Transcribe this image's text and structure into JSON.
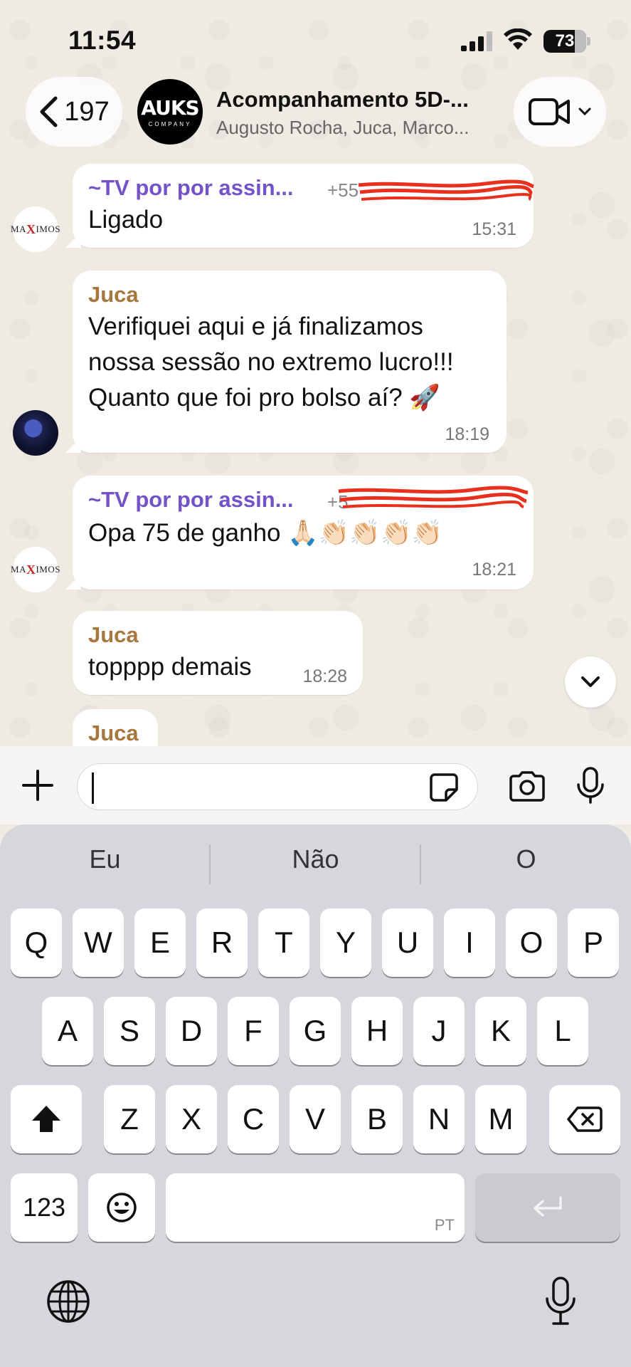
{
  "status_bar": {
    "time": "11:54",
    "battery_level": "73"
  },
  "header": {
    "back_count": "197",
    "group_logo_text": "AUKS",
    "group_logo_subtext": "COMPANY",
    "title": "Acompanhamento 5D-...",
    "subtitle": "Augusto Rocha, Juca, Marco..."
  },
  "messages": [
    {
      "sender": "~TV por por assin...",
      "phone": "+55",
      "text_lines": [
        "Ligado"
      ],
      "time": "15:31",
      "avatar": "maximos"
    },
    {
      "sender": "Juca",
      "text_lines": [
        "Verifiquei aqui e já finalizamos",
        "nossa sessão no extremo lucro!!!",
        "Quanto que foi pro bolso aí? 🚀"
      ],
      "time": "18:19",
      "avatar": "juca"
    },
    {
      "sender": "~TV por por assin...",
      "phone": "+5",
      "text_lines": [
        "Opa 75 de ganho 🙏🏻👏🏻👏🏻👏🏻👏🏻"
      ],
      "time": "18:21",
      "avatar": "maximos"
    },
    {
      "sender": "Juca",
      "text_lines": [
        "topppp demais"
      ],
      "time": "18:28"
    },
    {
      "sender": "Juca",
      "text_lines": [],
      "time": ""
    }
  ],
  "avatar_maximos_text": {
    "left": "MA",
    "x": "X",
    "right": "IMOS"
  },
  "composer": {
    "placeholder": ""
  },
  "keyboard": {
    "suggestions": [
      "Eu",
      "Não",
      "O"
    ],
    "row1": [
      "Q",
      "W",
      "E",
      "R",
      "T",
      "Y",
      "U",
      "I",
      "O",
      "P"
    ],
    "row2": [
      "A",
      "S",
      "D",
      "F",
      "G",
      "H",
      "J",
      "K",
      "L"
    ],
    "row3": [
      "Z",
      "X",
      "C",
      "V",
      "B",
      "N",
      "M"
    ],
    "numbers_key": "123",
    "space_language": "PT"
  },
  "colors": {
    "chat_bg": "#efeae2",
    "sender_purple": "#7453c8",
    "sender_brown": "#a8773e",
    "keyboard_bg": "#d5d7dd"
  },
  "icons": [
    "chevron-left-icon",
    "video-camera-icon",
    "chevron-down-icon",
    "plus-icon",
    "sticker-icon",
    "camera-icon",
    "microphone-icon",
    "shift-icon",
    "backspace-icon",
    "emoji-icon",
    "return-icon",
    "globe-icon",
    "signal-icon",
    "wifi-icon",
    "battery-icon"
  ]
}
